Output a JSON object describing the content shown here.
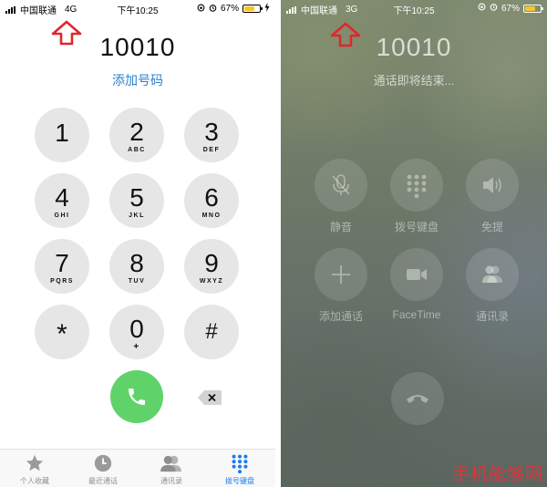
{
  "left": {
    "status": {
      "carrier": "中国联通",
      "network": "4G",
      "time": "下午10:25",
      "battery": "67%"
    },
    "number": "10010",
    "add_number": "添加号码",
    "keys": [
      {
        "digit": "1",
        "letters": ""
      },
      {
        "digit": "2",
        "letters": "ABC"
      },
      {
        "digit": "3",
        "letters": "DEF"
      },
      {
        "digit": "4",
        "letters": "GHI"
      },
      {
        "digit": "5",
        "letters": "JKL"
      },
      {
        "digit": "6",
        "letters": "MNO"
      },
      {
        "digit": "7",
        "letters": "PQRS"
      },
      {
        "digit": "8",
        "letters": "TUV"
      },
      {
        "digit": "9",
        "letters": "WXYZ"
      },
      {
        "digit": "*",
        "letters": ""
      },
      {
        "digit": "0",
        "letters": "+"
      },
      {
        "digit": "#",
        "letters": ""
      }
    ],
    "tabs": [
      {
        "label": "个人收藏",
        "icon": "star-icon"
      },
      {
        "label": "最近通话",
        "icon": "clock-icon"
      },
      {
        "label": "通讯录",
        "icon": "contacts-icon"
      },
      {
        "label": "拨号键盘",
        "icon": "keypad-icon",
        "active": true
      }
    ]
  },
  "right": {
    "status": {
      "carrier": "中国联通",
      "network": "3G",
      "time": "下午10:25",
      "battery": "67%"
    },
    "number": "10010",
    "call_status": "通话即将结束...",
    "controls": [
      {
        "label": "静音",
        "icon": "mute-icon"
      },
      {
        "label": "拨号键盘",
        "icon": "keypad-icon"
      },
      {
        "label": "免提",
        "icon": "speaker-icon"
      },
      {
        "label": "添加通话",
        "icon": "plus-icon"
      },
      {
        "label": "FaceTime",
        "icon": "video-camera-icon"
      },
      {
        "label": "通讯录",
        "icon": "contacts-icon"
      }
    ]
  },
  "watermark": "手机能够网",
  "colors": {
    "call_green": "#5fd36a",
    "link_blue": "#2a7fd1",
    "tab_active": "#1a7cf2",
    "arrow_red": "#e0262d",
    "battery_yellow": "#f7c52b"
  }
}
